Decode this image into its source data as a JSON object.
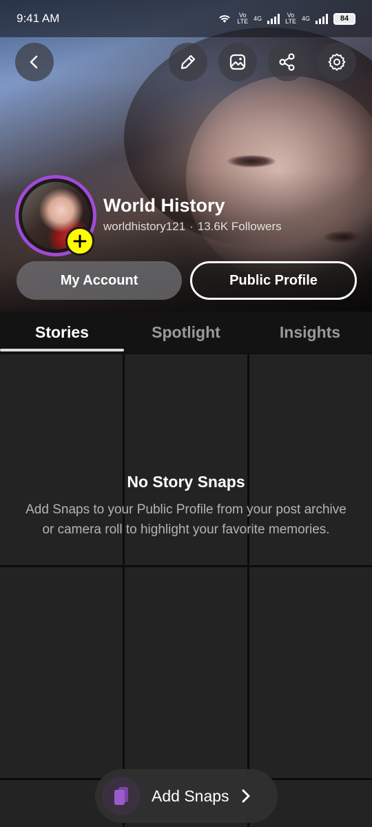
{
  "status_bar": {
    "time": "9:41 AM",
    "net_label_1_top": "Vo",
    "net_label_1_bottom": "LTE",
    "net_gen_1": "4G",
    "net_label_2_top": "Vo",
    "net_label_2_bottom": "LTE",
    "net_gen_2": "4G",
    "battery": "84"
  },
  "profile": {
    "display_name": "World History",
    "username": "worldhistory121",
    "separator": "·",
    "followers": "13.6K Followers"
  },
  "buttons": {
    "my_account": "My Account",
    "public_profile": "Public Profile"
  },
  "tabs": [
    {
      "label": "Stories",
      "active": true
    },
    {
      "label": "Spotlight",
      "active": false
    },
    {
      "label": "Insights",
      "active": false
    }
  ],
  "empty_state": {
    "title": "No Story Snaps",
    "description": "Add Snaps to your Public Profile from your post archive or camera roll to highlight your favorite memories."
  },
  "add_snaps": {
    "label": "Add Snaps"
  },
  "icons": {
    "back": "back-arrow-icon",
    "edit": "pencil-icon",
    "image": "image-icon",
    "share": "share-icon",
    "settings": "gear-icon",
    "add_story": "plus-icon",
    "add_snaps": "stack-icon",
    "chevron": "chevron-right-icon"
  },
  "colors": {
    "avatar_ring": "#a24ad6",
    "add_story_badge": "#fffc00",
    "add_snaps_icon": "#9b5cc9"
  }
}
